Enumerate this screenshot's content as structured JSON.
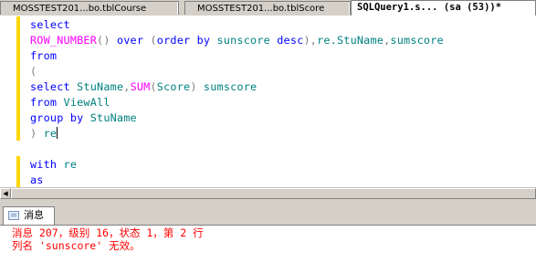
{
  "tabs": [
    {
      "label": "MOSSTEST201...bo.tblCourse",
      "active": false
    },
    {
      "label": "MOSSTEST201...bo.tblScore",
      "active": false
    },
    {
      "label": "SQLQuery1.s... (sa (53))*",
      "active": true
    }
  ],
  "editor": {
    "lines": [
      [
        {
          "t": "select",
          "c": "kw"
        }
      ],
      [
        {
          "t": "ROW_NUMBER",
          "c": "fn"
        },
        {
          "t": "() ",
          "c": "op"
        },
        {
          "t": "over",
          "c": "kw"
        },
        {
          "t": " (",
          "c": "op"
        },
        {
          "t": "order by",
          "c": "kw"
        },
        {
          "t": " sunscore ",
          "c": "id"
        },
        {
          "t": "desc",
          "c": "kw"
        },
        {
          "t": "),",
          "c": "op"
        },
        {
          "t": "re.StuName",
          "c": "id"
        },
        {
          "t": ",",
          "c": "op"
        },
        {
          "t": "sumscore",
          "c": "id"
        }
      ],
      [
        {
          "t": "from",
          "c": "kw"
        }
      ],
      [
        {
          "t": "(",
          "c": "op"
        }
      ],
      [
        {
          "t": "select",
          "c": "kw"
        },
        {
          "t": " StuName",
          "c": "id"
        },
        {
          "t": ",",
          "c": "op"
        },
        {
          "t": "SUM",
          "c": "fn"
        },
        {
          "t": "(",
          "c": "op"
        },
        {
          "t": "Score",
          "c": "id"
        },
        {
          "t": ") ",
          "c": "op"
        },
        {
          "t": "sumscore",
          "c": "id"
        }
      ],
      [
        {
          "t": "from",
          "c": "kw"
        },
        {
          "t": " ViewAll",
          "c": "id"
        }
      ],
      [
        {
          "t": "group by",
          "c": "kw"
        },
        {
          "t": " StuName",
          "c": "id"
        }
      ],
      [
        {
          "t": ") ",
          "c": "op"
        },
        {
          "t": "re",
          "c": "id"
        }
      ],
      [],
      [
        {
          "t": "with",
          "c": "kw"
        },
        {
          "t": " re",
          "c": "id"
        }
      ],
      [
        {
          "t": "as",
          "c": "kw"
        }
      ]
    ]
  },
  "messages_pane": {
    "tab_label": "消息",
    "lines": [
      "消息 207，级别 16，状态 1，第 2 行",
      "列名 'sunscore' 无效。"
    ]
  },
  "colors": {
    "keyword": "#0000ff",
    "function": "#ff00ff",
    "identifier": "#008080",
    "operator": "#808080",
    "error": "#ff0000",
    "gutter_changed": "#ffd800"
  }
}
